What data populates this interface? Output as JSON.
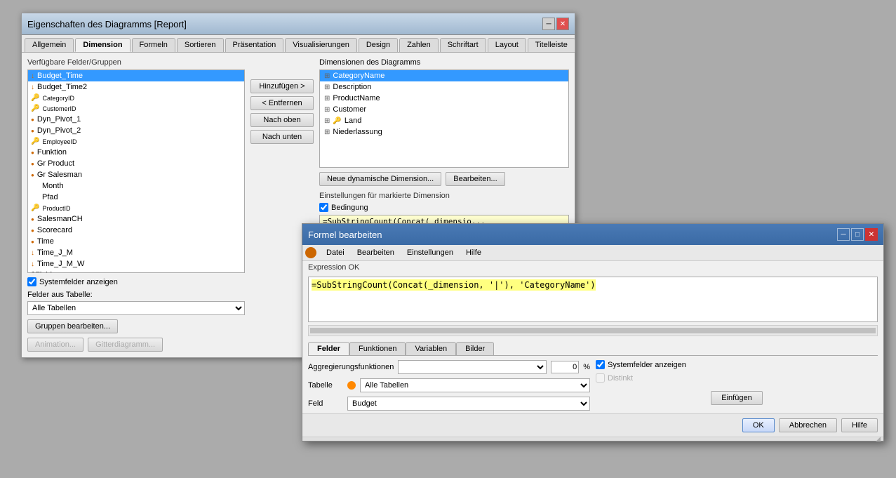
{
  "mainDialog": {
    "title": "Eigenschaften des Diagramms [Report]",
    "tabs": [
      {
        "label": "Allgemein"
      },
      {
        "label": "Dimension"
      },
      {
        "label": "Formeln"
      },
      {
        "label": "Sortieren"
      },
      {
        "label": "Präsentation"
      },
      {
        "label": "Visualisierungen"
      },
      {
        "label": "Design"
      },
      {
        "label": "Zahlen"
      },
      {
        "label": "Schriftart"
      },
      {
        "label": "Layout"
      },
      {
        "label": "Titelleiste"
      }
    ],
    "activeTab": 1,
    "leftPanel": {
      "label": "Verfügbare Felder/Gruppen",
      "items": [
        {
          "icon": "arrow",
          "text": "Budget_Time",
          "indented": false,
          "selected": true
        },
        {
          "icon": "arrow",
          "text": "Budget_Time2",
          "indented": false,
          "selected": false
        },
        {
          "icon": "key",
          "text": "CategoryID",
          "indented": false,
          "selected": false
        },
        {
          "icon": "key",
          "text": "CustomerID",
          "indented": false,
          "selected": false
        },
        {
          "icon": "circle",
          "text": "Dyn_Pivot_1",
          "indented": false,
          "selected": false
        },
        {
          "icon": "circle",
          "text": "Dyn_Pivot_2",
          "indented": false,
          "selected": false
        },
        {
          "icon": "key",
          "text": "EmployeeID",
          "indented": false,
          "selected": false
        },
        {
          "icon": "circle",
          "text": "Funktion",
          "indented": false,
          "selected": false
        },
        {
          "icon": "circle",
          "text": "Gr Product",
          "indented": false,
          "selected": false
        },
        {
          "icon": "circle",
          "text": "Gr Salesman",
          "indented": false,
          "selected": false
        },
        {
          "icon": "",
          "text": "Month",
          "indented": true,
          "selected": false
        },
        {
          "icon": "",
          "text": "Pfad",
          "indented": true,
          "selected": false
        },
        {
          "icon": "key",
          "text": "ProductID",
          "indented": false,
          "selected": false
        },
        {
          "icon": "circle",
          "text": "SalesmanCH",
          "indented": false,
          "selected": false
        },
        {
          "icon": "circle",
          "text": "Scorecard",
          "indented": false,
          "selected": false
        },
        {
          "icon": "circle",
          "text": "Time",
          "indented": false,
          "selected": false
        },
        {
          "icon": "arrow",
          "text": "Time_J_M",
          "indented": false,
          "selected": false
        },
        {
          "icon": "arrow",
          "text": "Time_J_M_W",
          "indented": false,
          "selected": false
        },
        {
          "icon": "",
          "text": "$Field",
          "indented": false,
          "selected": false
        }
      ],
      "systemCheckbox": {
        "checked": true,
        "label": "Systemfelder anzeigen"
      },
      "tableDropdownLabel": "Felder aus Tabelle:",
      "tableDropdownValue": "Alle Tabellen",
      "groupenBearbeitenBtn": "Gruppen bearbeiten...",
      "animationBtn": "Animation...",
      "gitterDiagrammBtn": "Gitterdiagramm..."
    },
    "middleButtons": [
      {
        "label": "Hinzufügen >"
      },
      {
        "label": "< Entfernen"
      },
      {
        "label": "Nach oben"
      },
      {
        "label": "Nach unten"
      }
    ],
    "rightPanel": {
      "label": "Dimensionen des Diagramms",
      "items": [
        {
          "icon": "plus",
          "text": "CategoryName",
          "selected": true
        },
        {
          "icon": "plus",
          "text": "Description",
          "selected": false
        },
        {
          "icon": "plus",
          "text": "ProductName",
          "selected": false
        },
        {
          "icon": "plus",
          "text": "Customer",
          "selected": false
        },
        {
          "icon": "plus-key",
          "text": "Land",
          "selected": false
        },
        {
          "icon": "plus",
          "text": "Niederlassung",
          "selected": false
        }
      ],
      "actionButtons": [
        {
          "label": "Neue dynamische Dimension..."
        },
        {
          "label": "Bearbeiten..."
        }
      ],
      "settingsSectionLabel": "Einstellungen für markierte Dimension",
      "conditionCheckLabel": "Bedingung",
      "conditionChecked": true,
      "formulaValue": "=SubStringCount(Concat(_dimensio...",
      "threeChecks": [
        {
          "checked": false,
          "label": ""
        },
        {
          "checked": false,
          "label": ""
        },
        {
          "checked": true,
          "label": ""
        }
      ]
    }
  },
  "formulaDialog": {
    "title": "Formel bearbeiten",
    "menuItems": [
      "Datei",
      "Bearbeiten",
      "Einstellungen",
      "Hilfe"
    ],
    "statusText": "Expression OK",
    "formulaText": "=SubStringCount(Concat(_dimension, '|'), 'CategoryName')",
    "formulaHighlight": "=SubStringCount(Concat(_dimension, '|'), 'CategoryName')",
    "tabs": [
      {
        "label": "Felder"
      },
      {
        "label": "Funktionen"
      },
      {
        "label": "Variablen"
      },
      {
        "label": "Bilder"
      }
    ],
    "activeTab": 0,
    "aggregierungLabel": "Aggregierungsfunktionen",
    "aggregierungValue": "",
    "percentValue": "0",
    "tabelleLabel": "Tabelle",
    "tabelleValue": "Alle Tabellen",
    "systemfeldCheckLabel": "Systemfelder anzeigen",
    "systemfeldChecked": true,
    "feldLabel": "Feld",
    "feldValue": "Budget",
    "distinktLabel": "Distinkt",
    "distinktChecked": false,
    "einfuegenBtn": "Einfügen",
    "okBtn": "OK",
    "abbrechenBtn": "Abbrechen",
    "hilfeBtn": "Hilfe"
  }
}
